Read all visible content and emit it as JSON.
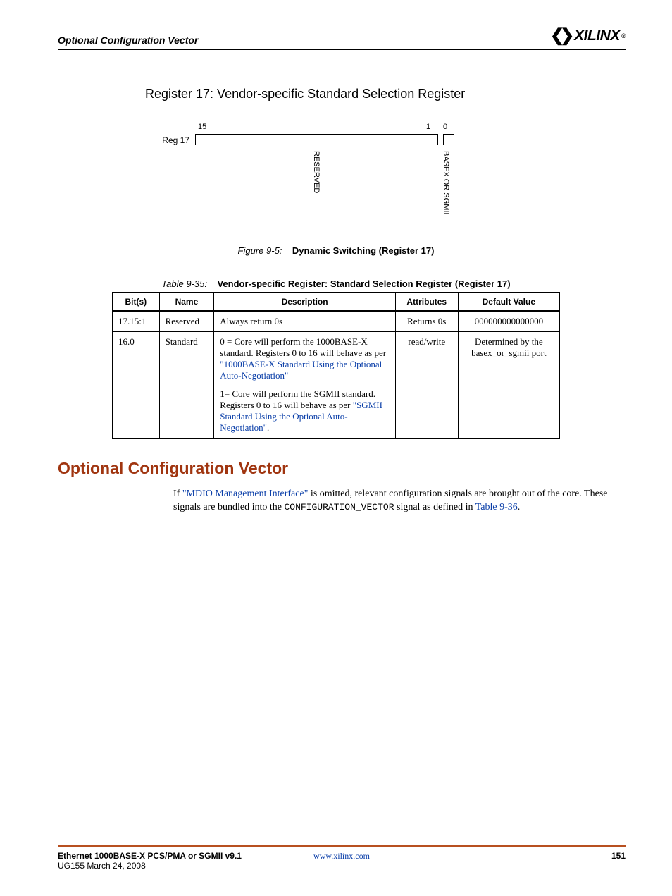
{
  "header": {
    "section_title": "Optional Configuration Vector",
    "brand": "XILINX",
    "registered": "®"
  },
  "heading": {
    "register_title": "Register 17: Vendor-specific Standard Selection Register"
  },
  "diagram": {
    "bit15": "15",
    "bit1": "1",
    "bit0": "0",
    "row_label": "Reg 17",
    "field_reserved": "RESERVED",
    "field_basex": "BASEX OR SGMII"
  },
  "figure_caption": {
    "number": "Figure 9-5:",
    "title": "Dynamic Switching (Register 17)"
  },
  "table_caption": {
    "number": "Table 9-35:",
    "title": "Vendor-specific Register: Standard Selection Register (Register 17)"
  },
  "table": {
    "headers": {
      "bits": "Bit(s)",
      "name": "Name",
      "description": "Description",
      "attributes": "Attributes",
      "default": "Default Value"
    },
    "rows": [
      {
        "bits": "17.15:1",
        "name": "Reserved",
        "desc": "Always return 0s",
        "attr": "Returns 0s",
        "def": "000000000000000"
      },
      {
        "bits": "16.0",
        "name": "Standard",
        "desc_p1_pre": "0 = Core will perform the 1000BASE-X standard. Registers 0 to 16 will behave as per ",
        "desc_p1_link": "\"1000BASE-X Standard Using the Optional Auto-Negotiation\"",
        "desc_p2_pre": "1= Core will perform the SGMII standard. Registers 0 to 16 will behave as per ",
        "desc_p2_link": "\"SGMII Standard Using the Optional Auto-Negotiation\"",
        "desc_p2_post": ".",
        "attr": "read/write",
        "def": "Determined by the basex_or_sgmii port"
      }
    ]
  },
  "section": {
    "heading": "Optional Configuration Vector",
    "body_pre": "If ",
    "body_link": "\"MDIO Management Interface\"",
    "body_mid1": " is omitted, relevant configuration signals are brought out of the core. These signals are bundled into the ",
    "body_mono": "CONFIGURATION_VECTOR",
    "body_mid2": " signal as defined in ",
    "body_link2": "Table 9-36",
    "body_post": "."
  },
  "footer": {
    "doc_title": "Ethernet 1000BASE-X PCS/PMA or SGMII v9.1",
    "doc_sub": "UG155 March 24, 2008",
    "url": "www.xilinx.com",
    "page": "151"
  }
}
